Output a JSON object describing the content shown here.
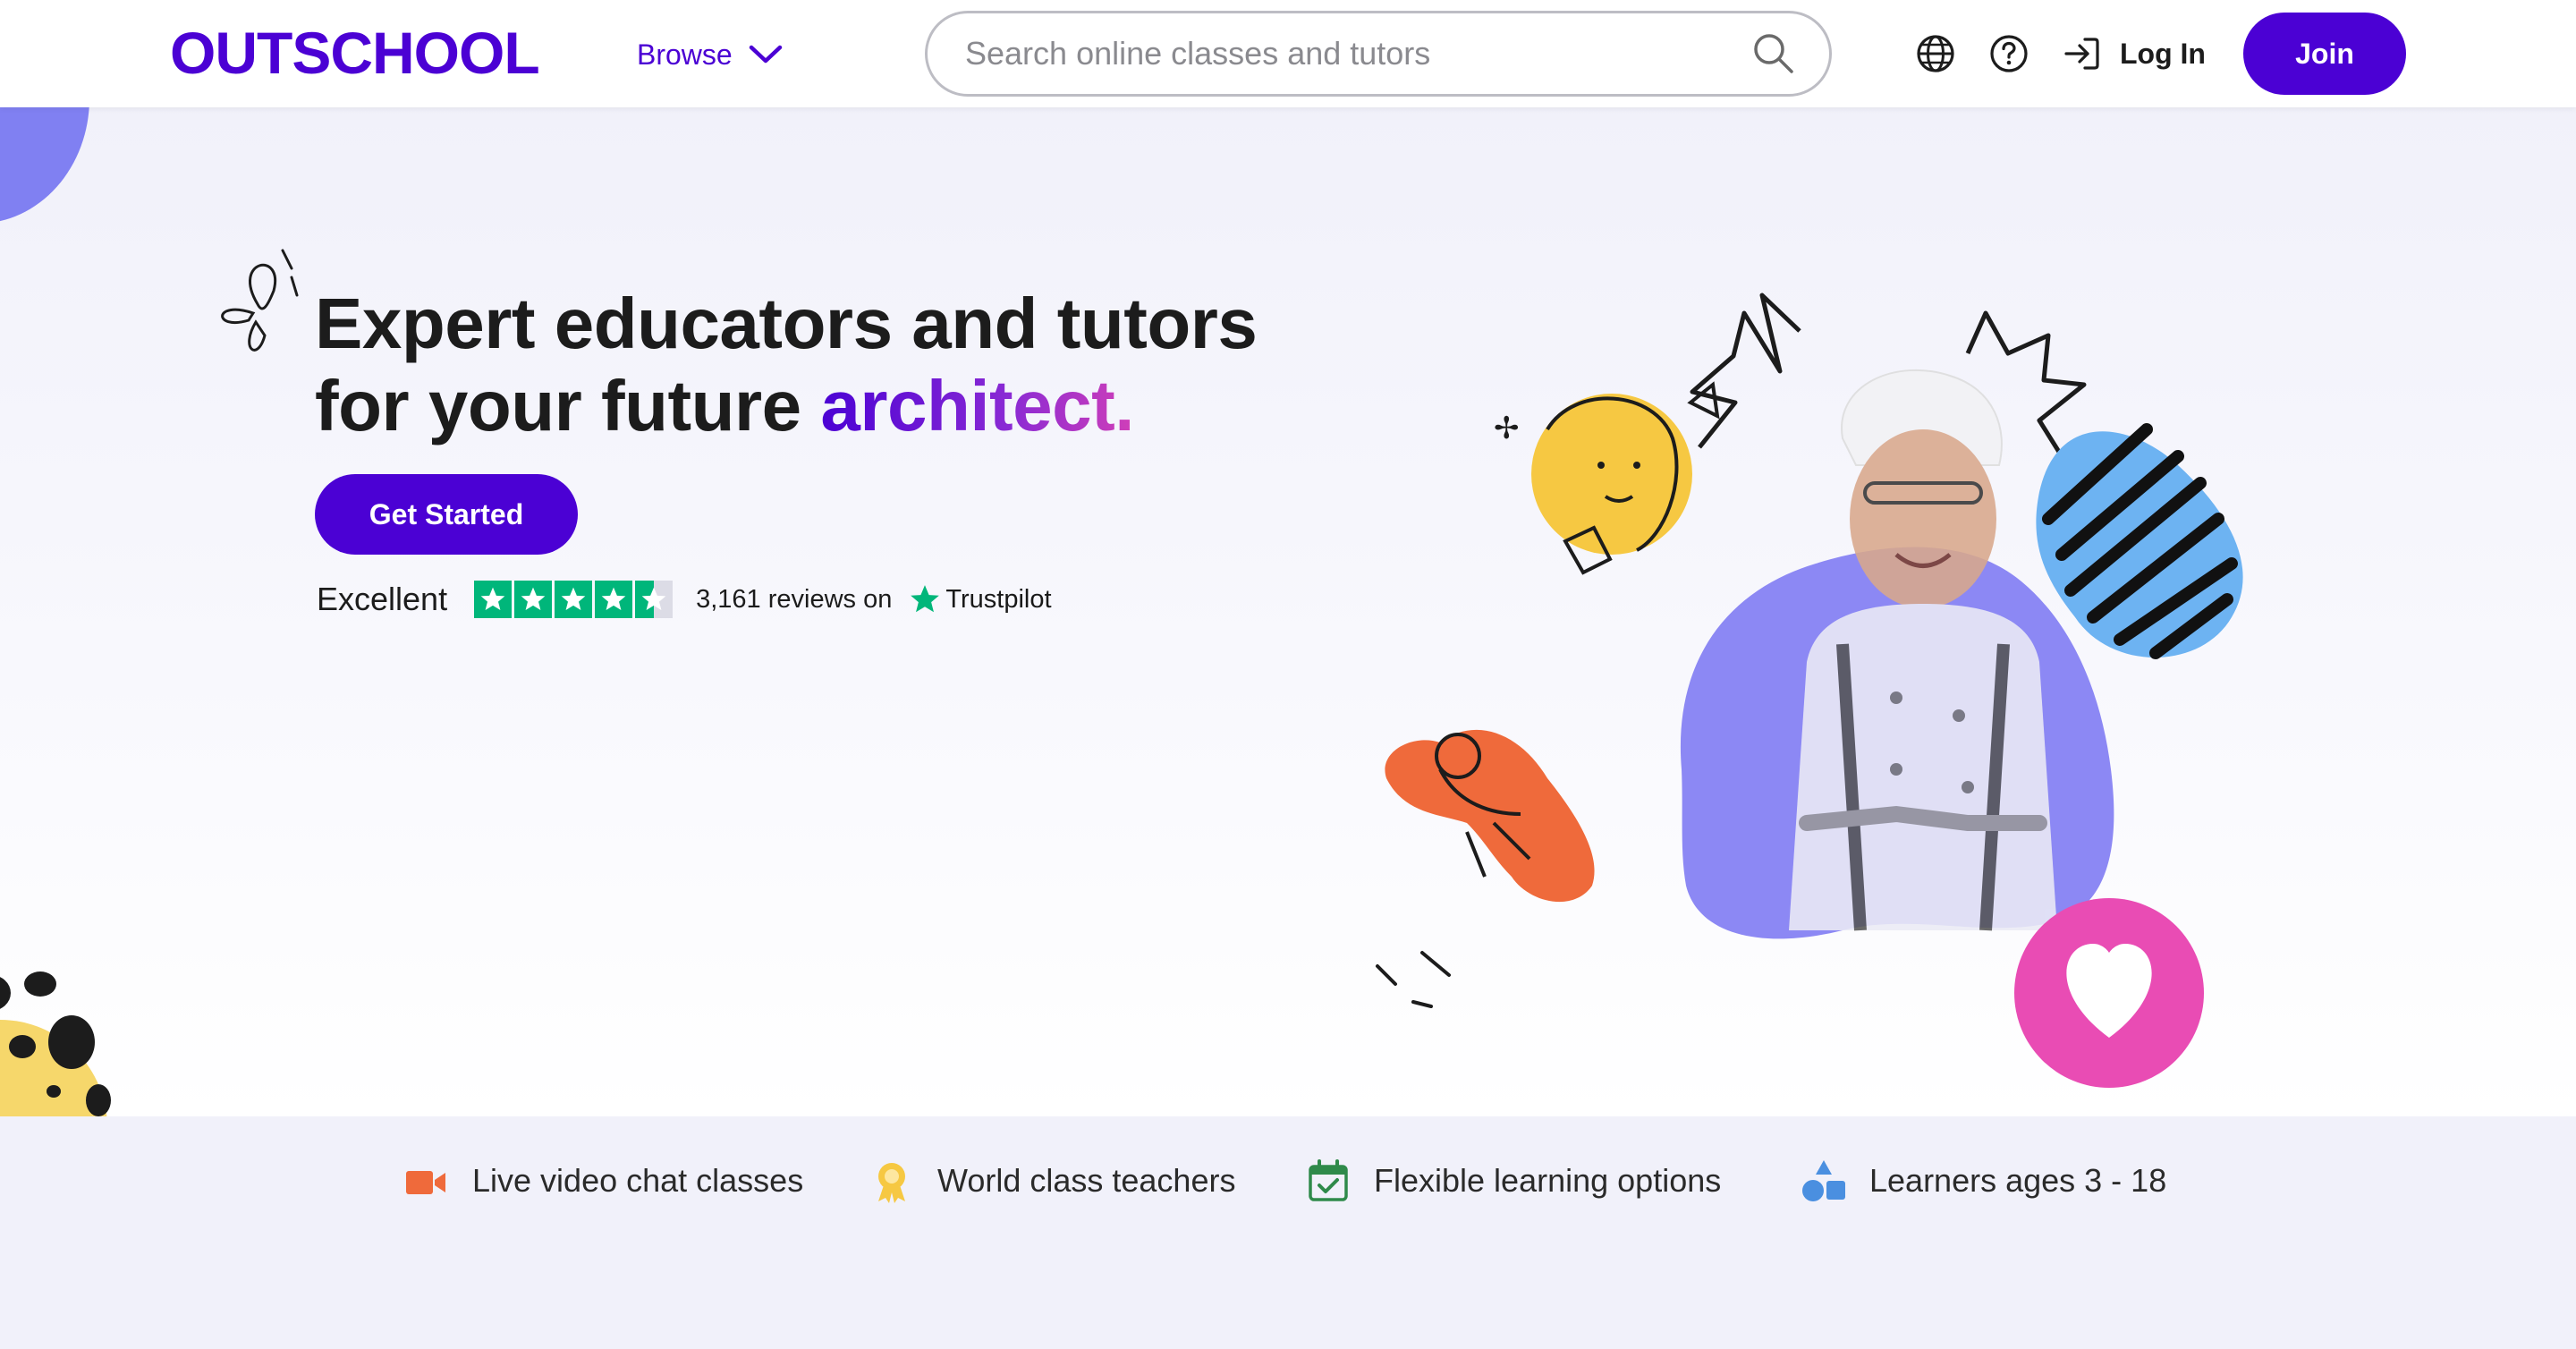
{
  "header": {
    "logo_text": "OUTSCHOOL",
    "browse_label": "Browse",
    "search_placeholder": "Search online classes and tutors",
    "login_label": "Log In",
    "join_label": "Join"
  },
  "hero": {
    "headline_line1": "Expert educators and tutors",
    "headline_line2_prefix": "for your future ",
    "headline_accent": "architect.",
    "cta_label": "Get Started",
    "rating_word": "Excellent",
    "rating_stars": 4.5,
    "review_count": "3,161",
    "reviews_on": "reviews on",
    "trustpilot": "Trustpilot"
  },
  "features": [
    {
      "icon": "video-camera-icon",
      "label": "Live video chat classes"
    },
    {
      "icon": "award-ribbon-icon",
      "label": "World class teachers"
    },
    {
      "icon": "calendar-check-icon",
      "label": "Flexible learning options"
    },
    {
      "icon": "shapes-icon",
      "label": "Learners ages 3 - 18"
    }
  ],
  "colors": {
    "brand": "#4b01d4",
    "trustpilot_green": "#00b67a",
    "heart_pink": "#e94cb4",
    "blob_blue": "#8080f2",
    "hero_bg": "#f1f1fa"
  }
}
